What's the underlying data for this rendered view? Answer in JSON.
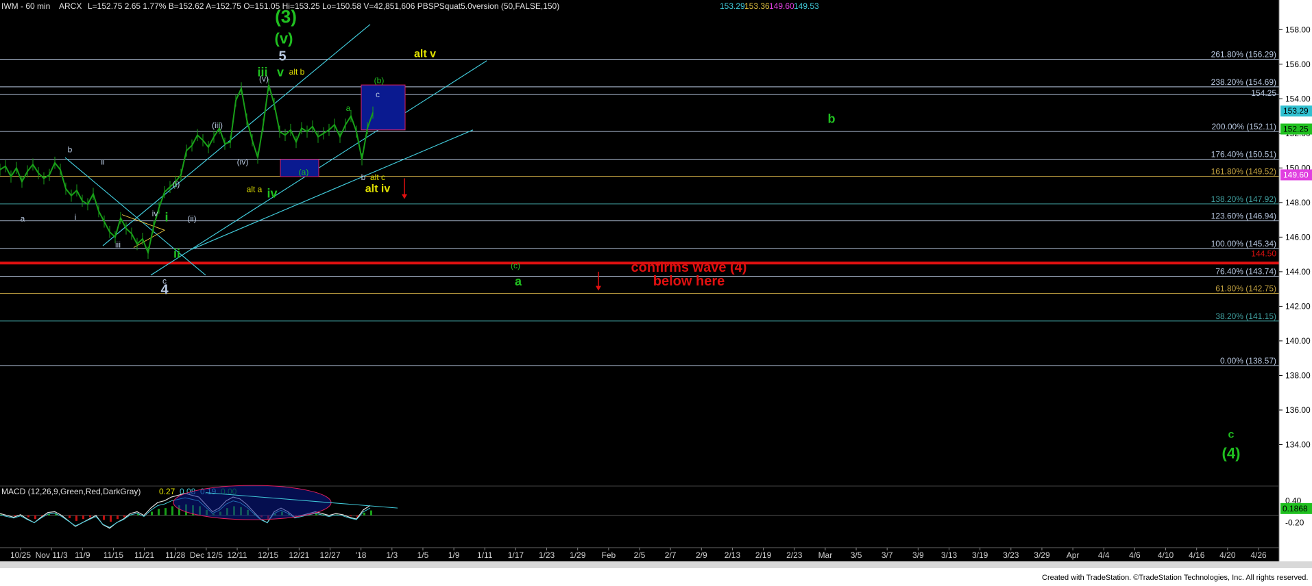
{
  "header": {
    "symbol": "IWM - 60 min",
    "exchange": "ARCX",
    "stats": "L=152.75  2.65  1.77%  B=152.62  A=152.75  O=151.05  Hi=153.25  Lo=150.58  V=42,851,606  PBSPSquat5.0version (50,FALSE,150)",
    "ind": [
      {
        "text": "153.29",
        "color": "#40c8d8"
      },
      {
        "text": "153.36",
        "color": "#e0c040"
      },
      {
        "text": "149.60",
        "color": "#e040e0"
      },
      {
        "text": "149.53",
        "color": "#40c8d8"
      }
    ]
  },
  "macd": {
    "label": "MACD (12,26,9,Green,Red,DarkGray)",
    "values": [
      {
        "text": "0.27",
        "color": "#e0e000"
      },
      {
        "text": "0.08",
        "color": "#40c8d8"
      },
      {
        "text": "0.19",
        "color": "#40c8d8"
      },
      {
        "text": "0.00",
        "color": "#00a000"
      }
    ],
    "ticks": [
      "0.40",
      "-0.20"
    ],
    "current": "0.1868"
  },
  "footer": "Created with TradeStation. ©TradeStation Technologies, Inc. All rights reserved.",
  "chart_data": {
    "type": "line",
    "title": "IWM - 60 min",
    "ylim": [
      132,
      159
    ],
    "y_ticks": [
      "158.00",
      "156.00",
      "154.00",
      "152.00",
      "150.00",
      "148.00",
      "146.00",
      "144.00",
      "142.00",
      "140.00",
      "138.00",
      "136.00",
      "134.00"
    ],
    "x_ticks": [
      "10/25",
      "Nov 11/3",
      "11/9",
      "11/15",
      "11/21",
      "11/28",
      "Dec 12/5",
      "12/11",
      "12/15",
      "12/21",
      "12/27",
      "'18",
      "1/3",
      "1/5",
      "1/9",
      "1/11",
      "1/17",
      "1/23",
      "1/29",
      "Feb",
      "2/5",
      "2/7",
      "2/9",
      "2/13",
      "2/19",
      "2/23",
      "Mar",
      "3/5",
      "3/7",
      "3/9",
      "3/13",
      "3/19",
      "3/23",
      "3/29",
      "Apr",
      "4/4",
      "4/6",
      "4/10",
      "4/16",
      "4/20",
      "4/26"
    ],
    "price_badges": [
      {
        "text": "153.29",
        "value": 153.29,
        "bg": "#30c0d0",
        "fg": "#000"
      },
      {
        "text": "152.25",
        "value": 152.25,
        "bg": "#20c020",
        "fg": "#000"
      },
      {
        "text": "149.60",
        "value": 149.6,
        "bg": "#e040e0",
        "fg": "#fff"
      }
    ],
    "fib_levels": [
      {
        "text": "261.80% (156.29)",
        "value": 156.29,
        "color": "#b8c8e0"
      },
      {
        "text": "238.20% (154.69)",
        "value": 154.69,
        "color": "#b8c8e0"
      },
      {
        "text": "200.00% (152.11)",
        "value": 152.11,
        "color": "#b8c8e0"
      },
      {
        "text": "176.40% (150.51)",
        "value": 150.51,
        "color": "#b8c8e0"
      },
      {
        "text": "161.80% (149.52)",
        "value": 149.52,
        "color": "#c0a040"
      },
      {
        "text": "138.20% (147.92)",
        "value": 147.92,
        "color": "#40a0a0"
      },
      {
        "text": "123.60% (146.94)",
        "value": 146.94,
        "color": "#b8c8e0"
      },
      {
        "text": "100.00% (145.34)",
        "value": 145.34,
        "color": "#b8c8e0"
      },
      {
        "text": "76.40% (143.74)",
        "value": 143.74,
        "color": "#b8c8e0"
      },
      {
        "text": "61.80% (142.75)",
        "value": 142.75,
        "color": "#c0a040"
      },
      {
        "text": "38.20% (141.15)",
        "value": 141.15,
        "color": "#40a0a0"
      },
      {
        "text": "0.00% (138.57)",
        "value": 138.57,
        "color": "#b8c8e0"
      }
    ],
    "line_154": {
      "text": "154.25",
      "value": 154.25
    },
    "red_line": {
      "text": "144.50",
      "value": 144.5
    },
    "annotations": [
      {
        "text": "(3)",
        "color": "#20c020",
        "size": 26,
        "x": 417,
        "v": 158.4
      },
      {
        "text": "(v)",
        "color": "#20c020",
        "size": 22,
        "x": 414,
        "v": 157.2
      },
      {
        "text": "5",
        "color": "#b8c8e0",
        "size": 20,
        "x": 412,
        "v": 156.2
      },
      {
        "text": "iii",
        "color": "#20c020",
        "size": 18,
        "x": 383,
        "v": 155.3
      },
      {
        "text": "v",
        "color": "#20c020",
        "size": 18,
        "x": 409,
        "v": 155.3
      },
      {
        "text": "alt b",
        "color": "#e0e000",
        "size": 12,
        "x": 433,
        "v": 155.4
      },
      {
        "text": "alt v",
        "color": "#e0e000",
        "size": 16,
        "x": 620,
        "v": 156.4
      },
      {
        "text": "(b)",
        "color": "#20c020",
        "size": 12,
        "x": 553,
        "v": 154.9
      },
      {
        "text": "c",
        "color": "#b8c8e0",
        "size": 12,
        "x": 551,
        "v": 154.1
      },
      {
        "text": "b",
        "color": "#20c020",
        "size": 18,
        "x": 1213,
        "v": 152.6
      },
      {
        "text": "(v)",
        "color": "#b8c8e0",
        "size": 12,
        "x": 385,
        "v": 155.0
      },
      {
        "text": "(iii)",
        "color": "#b8c8e0",
        "size": 12,
        "x": 317,
        "v": 152.3
      },
      {
        "text": "(iv)",
        "color": "#b8c8e0",
        "size": 12,
        "x": 354,
        "v": 150.2
      },
      {
        "text": "(a)",
        "color": "#20c020",
        "size": 12,
        "x": 443,
        "v": 149.6
      },
      {
        "text": "a",
        "color": "#20c020",
        "size": 12,
        "x": 508,
        "v": 153.3
      },
      {
        "text": "b",
        "color": "#b8c8e0",
        "size": 12,
        "x": 530,
        "v": 149.3
      },
      {
        "text": "alt c",
        "color": "#e0e000",
        "size": 12,
        "x": 551,
        "v": 149.3
      },
      {
        "text": "alt iv",
        "color": "#e0e000",
        "size": 16,
        "x": 551,
        "v": 148.6
      },
      {
        "text": "alt a",
        "color": "#e0e000",
        "size": 12,
        "x": 371,
        "v": 148.6
      },
      {
        "text": "iv",
        "color": "#20c020",
        "size": 18,
        "x": 397,
        "v": 148.3
      },
      {
        "text": "b",
        "color": "#b8c8e0",
        "size": 12,
        "x": 102,
        "v": 150.9
      },
      {
        "text": "ii",
        "color": "#b8c8e0",
        "size": 12,
        "x": 150,
        "v": 150.2
      },
      {
        "text": "(i)",
        "color": "#b8c8e0",
        "size": 12,
        "x": 257,
        "v": 148.9
      },
      {
        "text": "(ii)",
        "color": "#b8c8e0",
        "size": 12,
        "x": 280,
        "v": 146.9
      },
      {
        "text": "iv",
        "color": "#b8c8e0",
        "size": 12,
        "x": 226,
        "v": 147.2
      },
      {
        "text": "i",
        "color": "#20c020",
        "size": 18,
        "x": 243,
        "v": 146.9
      },
      {
        "text": "i",
        "color": "#b8c8e0",
        "size": 12,
        "x": 110,
        "v": 147.0
      },
      {
        "text": "a",
        "color": "#b8c8e0",
        "size": 12,
        "x": 33,
        "v": 146.9
      },
      {
        "text": "iii",
        "color": "#b8c8e0",
        "size": 12,
        "x": 172,
        "v": 145.4
      },
      {
        "text": "ii",
        "color": "#20c020",
        "size": 18,
        "x": 258,
        "v": 144.8
      },
      {
        "text": "c",
        "color": "#b8c8e0",
        "size": 12,
        "x": 240,
        "v": 143.3
      },
      {
        "text": "4",
        "color": "#b8c8e0",
        "size": 20,
        "x": 240,
        "v": 142.7
      },
      {
        "text": "(c)",
        "color": "#20c020",
        "size": 12,
        "x": 752,
        "v": 144.2
      },
      {
        "text": "a",
        "color": "#20c020",
        "size": 18,
        "x": 756,
        "v": 143.2
      },
      {
        "text": "confirms wave (4)",
        "color": "#e01010",
        "size": 20,
        "x": 1005,
        "v": 144.0
      },
      {
        "text": "below here",
        "color": "#e01010",
        "size": 20,
        "x": 1005,
        "v": 143.2
      },
      {
        "text": "c",
        "color": "#20c020",
        "size": 16,
        "x": 1796,
        "v": 134.4
      },
      {
        "text": "(4)",
        "color": "#20c020",
        "size": 22,
        "x": 1796,
        "v": 133.2
      }
    ],
    "price_series_x": [
      0,
      8,
      16,
      24,
      32,
      40,
      48,
      56,
      64,
      72,
      80,
      88,
      96,
      104,
      112,
      120,
      128,
      136,
      144,
      152,
      160,
      168,
      176,
      184,
      192,
      200,
      208,
      216,
      224,
      232,
      240,
      248,
      256,
      264,
      272,
      280,
      288,
      296,
      304,
      312,
      320,
      328,
      336,
      344,
      352,
      360,
      368,
      376,
      384,
      392,
      400,
      408,
      416,
      424,
      432,
      440,
      448,
      456,
      464,
      472,
      480,
      488,
      496,
      504,
      512,
      520,
      528,
      536,
      544
    ],
    "price_series": [
      149.9,
      150.1,
      149.5,
      150.0,
      149.2,
      149.8,
      150.2,
      149.7,
      149.4,
      149.6,
      150.3,
      149.9,
      148.8,
      148.4,
      148.7,
      148.1,
      147.9,
      148.5,
      147.5,
      146.9,
      146.3,
      146.0,
      147.1,
      146.5,
      146.2,
      145.6,
      145.9,
      145.1,
      146.6,
      147.7,
      148.6,
      148.9,
      149.2,
      149.6,
      151.0,
      151.3,
      151.9,
      151.6,
      151.2,
      151.8,
      152.3,
      151.4,
      151.5,
      153.9,
      154.6,
      152.8,
      151.6,
      150.6,
      152.5,
      154.8,
      153.7,
      152.1,
      151.9,
      152.2,
      151.5,
      152.3,
      152.1,
      152.4,
      151.8,
      152.0,
      152.2,
      152.5,
      151.8,
      152.5,
      153.0,
      152.1,
      150.5,
      152.3,
      153.2
    ],
    "macd_series": [
      0.05,
      0.0,
      -0.05,
      0.02,
      -0.1,
      -0.2,
      -0.05,
      0.08,
      0.1,
      0.0,
      -0.15,
      -0.3,
      -0.2,
      -0.1,
      0.0,
      -0.25,
      -0.35,
      -0.2,
      -0.1,
      0.05,
      0.1,
      0.0,
      0.2,
      0.35,
      0.4,
      0.5,
      0.55,
      0.6,
      0.55,
      0.5,
      0.3,
      0.1,
      0.2,
      0.4,
      0.5,
      0.45,
      0.3,
      0.1,
      -0.1,
      -0.2,
      0.1,
      0.2,
      0.1,
      -0.05,
      0.0,
      0.05,
      0.1,
      0.05,
      0.0,
      0.05,
      0.02,
      -0.05,
      -0.1,
      0.15,
      0.27
    ],
    "macd_ylim": [
      -0.6,
      0.8
    ]
  }
}
